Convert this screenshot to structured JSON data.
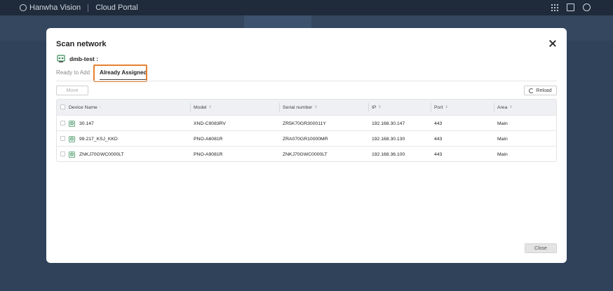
{
  "app": {
    "brand": "Hanwha Vision",
    "portal": "Cloud Portal"
  },
  "dialog": {
    "title": "Scan network",
    "site_name": "dmb-test :",
    "tabs": [
      {
        "label": "Ready to Add",
        "active": false
      },
      {
        "label": "Already Assigned",
        "active": true
      }
    ],
    "move_label": "Move",
    "reload_label": "Reload",
    "close_label": "Close",
    "highlight_color": "#e8802f"
  },
  "table": {
    "columns": [
      "Device Name",
      "Model",
      "Serial number",
      "IP",
      "Port",
      "Area"
    ],
    "rows": [
      {
        "name": "30.147",
        "model": "XND-C9083RV",
        "serial": "ZR5K70GR300011Y",
        "ip": "192.168.30.147",
        "port": "443",
        "area": "Main"
      },
      {
        "name": "99.217_KSJ_KKD",
        "model": "PNO-A6081R",
        "serial": "ZRA070GR10000MR",
        "ip": "192.168.30.130",
        "port": "443",
        "area": "Main"
      },
      {
        "name": "ZNKJ70GWC0000LT",
        "model": "PNO-A9081R",
        "serial": "ZNKJ70GWC0000LT",
        "ip": "192.168.36.100",
        "port": "443",
        "area": "Main"
      }
    ]
  }
}
